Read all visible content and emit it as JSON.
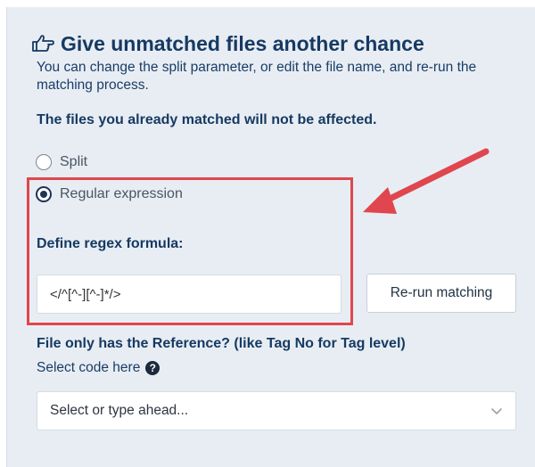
{
  "panel": {
    "title": "Give unmatched files another chance",
    "title_icon": "hand-pointing-right-icon",
    "subtitle": "You can change the split parameter, or edit the file name, and re-run the matching process.",
    "note": "The files you already matched will not be affected."
  },
  "options": {
    "split_label": "Split",
    "regex_label": "Regular expression",
    "selected": "Regular expression"
  },
  "regex": {
    "label": "Define regex formula:",
    "value": "</^[^-][^-]*/>",
    "rerun_label": "Re-run matching"
  },
  "reference": {
    "question": "File only has the Reference? (like Tag No for Tag level)",
    "select_code_label": "Select code here",
    "help_icon": "question-circle-icon",
    "dropdown_placeholder": "Select or type ahead..."
  },
  "annotation": {
    "highlight_color": "#e0464d",
    "arrow_color": "#e0464d"
  }
}
